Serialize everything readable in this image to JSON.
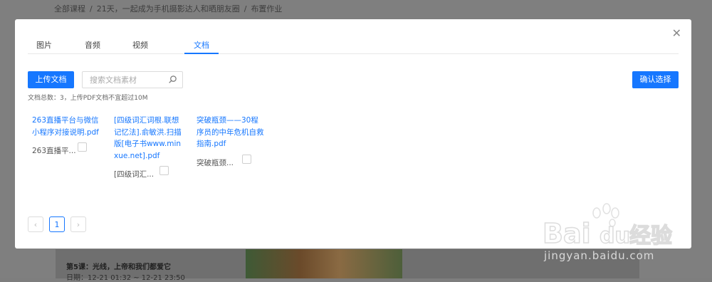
{
  "background": {
    "breadcrumb": [
      "全部课程",
      "21天，一起成为手机摄影达人和晒朋友圈",
      "布置作业"
    ],
    "lesson_title": "第5课：光线，上帝和我们都爱它",
    "lesson_date": "日期：12-21 01:32 ~ 12-21 23:50"
  },
  "modal": {
    "tabs": [
      "图片",
      "音频",
      "视频",
      "文档"
    ],
    "active_tab": "文档",
    "upload_label": "上传文档",
    "search_placeholder": "搜索文档素材",
    "confirm_label": "确认选择",
    "stats": "文档总数：3，上传PDF文档不宜超过10M",
    "documents": [
      {
        "title": "263直播平台与微信小程序对接说明.pdf",
        "short": "263直播平..."
      },
      {
        "title": "[四级词汇词根.联想记忆法].俞敏洪.扫描版[电子书www.minxue.net].pdf",
        "short": "[四级词汇..."
      },
      {
        "title": "突破瓶颈——30程序员的中年危机自救指南.pdf",
        "short": "突破瓶颈..."
      }
    ],
    "pagination": {
      "prev": "‹",
      "current": "1",
      "next": "›"
    }
  },
  "watermark": {
    "brand": "Bai",
    "brand2": "du",
    "label": "经验",
    "url": "jingyan.baidu.com"
  },
  "colors": {
    "primary": "#1677ff",
    "overlay": "#7f7f7f"
  }
}
